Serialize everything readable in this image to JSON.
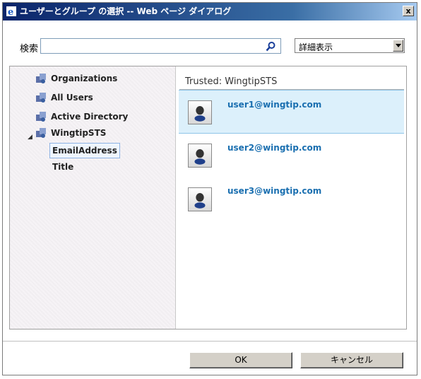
{
  "window": {
    "title": "ユーザーとグループ の選択 -- Web ページ ダイアログ",
    "close_label": "x"
  },
  "search": {
    "label": "検索",
    "value": "",
    "placeholder": ""
  },
  "view_select": {
    "selected": "詳細表示"
  },
  "tree": {
    "items": [
      {
        "label": "Organizations"
      },
      {
        "label": "All Users"
      },
      {
        "label": "Active Directory"
      },
      {
        "label": "WingtipSTS"
      }
    ],
    "children": [
      {
        "label": "EmailAddress"
      },
      {
        "label": "Title"
      }
    ]
  },
  "results": {
    "title": "Trusted: WingtipSTS",
    "users": [
      {
        "name": "user1@wingtip.com"
      },
      {
        "name": "user2@wingtip.com"
      },
      {
        "name": "user3@wingtip.com"
      }
    ]
  },
  "buttons": {
    "ok": "OK",
    "cancel": "キャンセル"
  }
}
